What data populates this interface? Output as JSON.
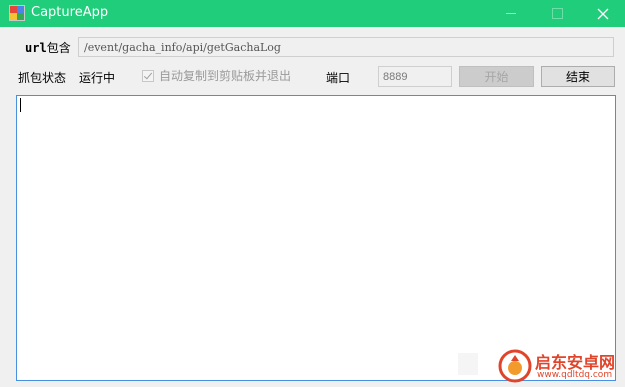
{
  "window": {
    "title": "CaptureApp",
    "accent_color": "#1fcd7a",
    "icons": {
      "app": "capture-app-icon",
      "minimize": "minimize-icon",
      "maximize": "maximize-icon",
      "close": "close-icon"
    },
    "close_glyph": "✕"
  },
  "url_row": {
    "label_prefix": "url",
    "label_suffix": "包含",
    "value": "/event/gacha_info/api/getGachaLog"
  },
  "status_row": {
    "state_label": "抓包状态",
    "state_value": "运行中",
    "auto_copy_label": "自动复制到剪贴板并退出",
    "auto_copy_checked": true,
    "port_label": "端口",
    "port_value": "8889",
    "start_label": "开始",
    "end_label": "结束"
  },
  "log": {
    "value": ""
  },
  "watermark": {
    "title": "启东安卓网",
    "url": "www.qdltdq.com",
    "color": "#e0452b"
  }
}
